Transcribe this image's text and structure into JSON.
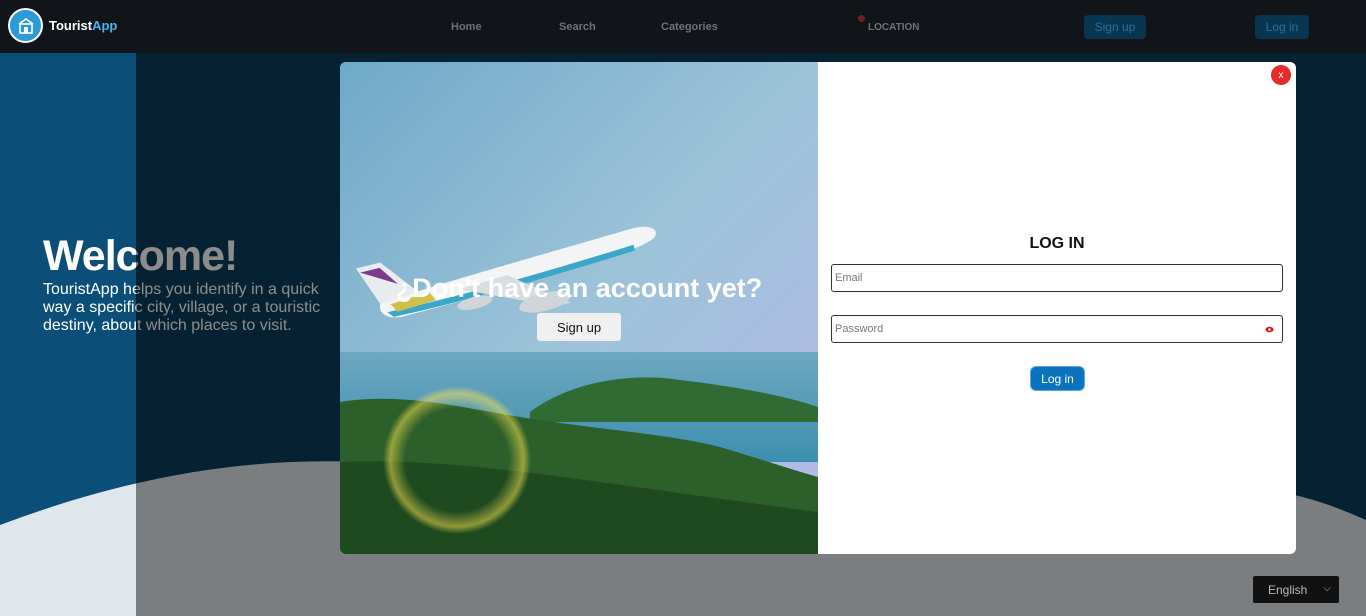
{
  "brand": {
    "name_a": "Tourist",
    "name_b": "App"
  },
  "nav": {
    "home": "Home",
    "search": "Search",
    "categories": "Categories",
    "location": "LOCATION",
    "signup": "Sign up",
    "login": "Log in"
  },
  "hero": {
    "title": "Welcome!",
    "text": "TouristApp helps you identify in a quick way a specific city, village, or a touristic destiny, about which places to visit."
  },
  "language": {
    "selected": "English"
  },
  "modal": {
    "promo_title": "¿Don't have an account yet?",
    "promo_button": "Sign up",
    "close": "x",
    "login_title": "LOG IN",
    "email_placeholder": "Email",
    "password_placeholder": "Password",
    "login_button": "Log in"
  },
  "colors": {
    "accent": "#0a73bd",
    "close": "#e62b2b",
    "navbar": "#111418"
  }
}
